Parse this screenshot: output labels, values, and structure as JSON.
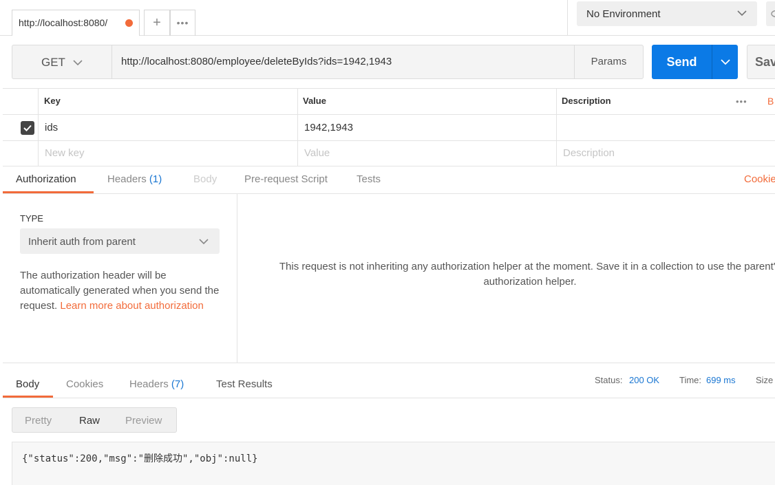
{
  "tabs": {
    "active_label": "http://localhost:8080/",
    "add_symbol": "+",
    "more_symbol": "•••"
  },
  "environment": {
    "selected": "No Environment"
  },
  "request": {
    "method": "GET",
    "url": "http://localhost:8080/employee/deleteByIds?ids=1942,1943",
    "params_label": "Params",
    "send_label": "Send",
    "save_label": "Sav"
  },
  "params_table": {
    "headers": [
      "Key",
      "Value",
      "Description"
    ],
    "rows": [
      {
        "key": "ids",
        "value": "1942,1943",
        "description": "",
        "checked": true
      }
    ],
    "new_row": {
      "key": "New key",
      "value": "Value",
      "description": "Description"
    },
    "more_symbol": "•••",
    "bulk_edit_label": "B"
  },
  "request_tabs": {
    "authorization": "Authorization",
    "headers": "Headers",
    "headers_count": "(1)",
    "body": "Body",
    "pre_request": "Pre-request Script",
    "tests": "Tests",
    "cookies": "Cookie"
  },
  "auth": {
    "type_label": "TYPE",
    "type_value": "Inherit auth from parent",
    "description": "The authorization header will be automatically generated when you send the request.",
    "learn_more": "Learn more about authorization",
    "message": "This request is not inheriting any authorization helper at the moment. Save it in a collection to use the parent's authorization helper."
  },
  "response": {
    "tabs": {
      "body": "Body",
      "cookies": "Cookies",
      "headers": "Headers",
      "headers_count": "(7)",
      "test_results": "Test Results"
    },
    "status_label": "Status:",
    "status_value": "200 OK",
    "time_label": "Time:",
    "time_value": "699 ms",
    "size_label": "Size",
    "format_tabs": {
      "pretty": "Pretty",
      "raw": "Raw",
      "preview": "Preview"
    },
    "body_text": "{\"status\":200,\"msg\":\"删除成功\",\"obj\":null}"
  },
  "colors": {
    "accent_orange": "#f26b3a",
    "send_blue": "#0b7ae6",
    "meta_blue": "#1976d2"
  }
}
